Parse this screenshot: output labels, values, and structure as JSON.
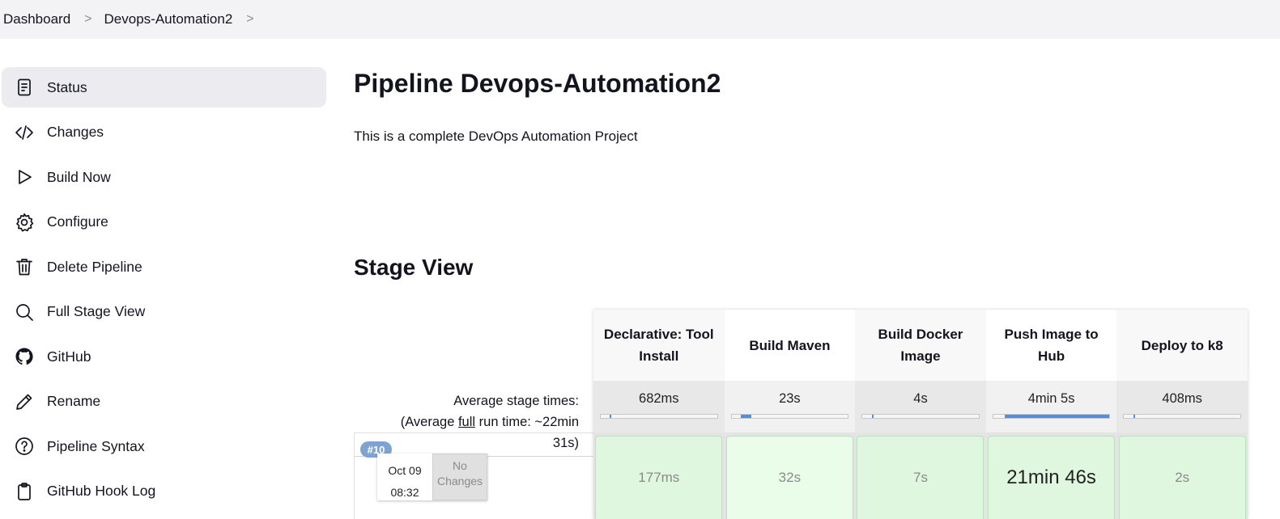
{
  "breadcrumb": {
    "items": [
      "Dashboard",
      "Devops-Automation2"
    ],
    "separator": ">"
  },
  "sidebar": {
    "items": [
      {
        "label": "Status",
        "icon": "status-icon",
        "active": true
      },
      {
        "label": "Changes",
        "icon": "code-icon"
      },
      {
        "label": "Build Now",
        "icon": "play-icon"
      },
      {
        "label": "Configure",
        "icon": "gear-icon"
      },
      {
        "label": "Delete Pipeline",
        "icon": "trash-icon"
      },
      {
        "label": "Full Stage View",
        "icon": "search-icon"
      },
      {
        "label": "GitHub",
        "icon": "github-icon"
      },
      {
        "label": "Rename",
        "icon": "pencil-icon"
      },
      {
        "label": "Pipeline Syntax",
        "icon": "help-icon"
      },
      {
        "label": "GitHub Hook Log",
        "icon": "clipboard-icon"
      }
    ]
  },
  "main": {
    "title": "Pipeline Devops-Automation2",
    "description": "This is a complete DevOps Automation Project",
    "stage_view_title": "Stage View"
  },
  "stage_view": {
    "avg_label_line1": "Average stage times:",
    "avg_label_line2_prefix": "(Average ",
    "avg_label_line2_link": "full",
    "avg_label_line2_suffix": " run time: ~22min",
    "avg_label_line3": "31s)",
    "stages": [
      {
        "name": "Declarative: Tool Install",
        "avg": "682ms",
        "avg_fraction": 0.003,
        "run": "177ms"
      },
      {
        "name": "Build Maven",
        "avg": "23s",
        "avg_fraction": 0.09,
        "run": "32s"
      },
      {
        "name": "Build Docker Image",
        "avg": "4s",
        "avg_fraction": 0.015,
        "run": "7s"
      },
      {
        "name": "Push Image to Hub",
        "avg": "4min 5s",
        "avg_fraction": 0.9,
        "run": "21min 46s"
      },
      {
        "name": "Deploy to k8",
        "avg": "408ms",
        "avg_fraction": 0.002,
        "run": "2s"
      }
    ],
    "build": {
      "number": "#10",
      "date": "Oct 09",
      "time": "08:32",
      "changes": "No Changes"
    }
  },
  "colors": {
    "success_cell": "#dff6df",
    "bar_fill": "#4f8ee6",
    "build_badge": "#7fa3d0"
  }
}
